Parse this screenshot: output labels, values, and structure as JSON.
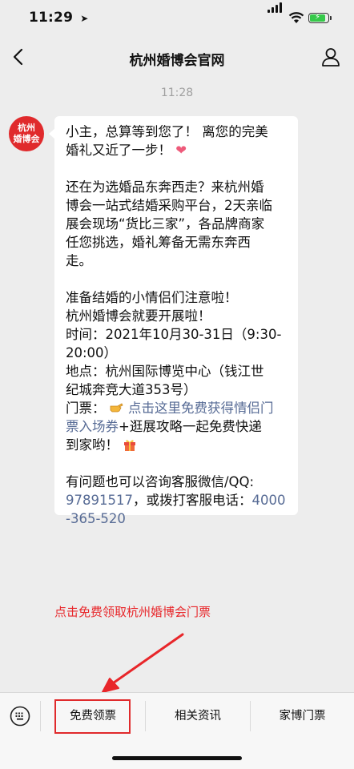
{
  "status": {
    "time": "11:29",
    "location_icon": "location-arrow-icon",
    "signal_icon": "cellular-signal-icon",
    "wifi_icon": "wifi-icon",
    "battery_icon": "battery-charging-icon",
    "battery_level_fraction": 0.85
  },
  "nav": {
    "back_icon": "chevron-left-icon",
    "title": "杭州婚博会官网",
    "profile_icon": "person-icon"
  },
  "chat": {
    "timestamp": "11:28",
    "avatar_text_line1": "杭州",
    "avatar_text_line2": "婚博会",
    "message": {
      "p1_line1": "小主，总算等到您了！ 离您的完美",
      "p1_line2": "婚礼又近了一步！",
      "heart_emoji": "❤",
      "p2_line1": "还在为选婚品东奔西走？来杭州婚",
      "p2_line2": "博会一站式结婚采购平台，2天亲临",
      "p2_line3": "展会现场“货比三家”，各品牌商家",
      "p2_line4": "任您挑选，婚礼筹备无需东奔西",
      "p2_line5": "走。",
      "p3_line1": "准备结婚的小情侣们注意啦！",
      "p3_line2": "杭州婚博会就要开展啦！",
      "p3_line3": "时间：2021年10月30-31日（9:30-",
      "p3_line4": "20:00）",
      "p3_line5": "地点：杭州国际博览中心（钱江世",
      "p3_line6": "纪城奔竞大道353号）",
      "p3_ticket_label": "门票：",
      "p3_ticket_link_a": "点击这里免费获得情侣门",
      "p3_ticket_link_b": "票入场券",
      "p3_ticket_rest": "+逛展攻略一起免费快递",
      "p3_line9": "到家哟！",
      "gift_emoji": "gift-icon",
      "hand_emoji": "pointing-hand-icon",
      "p4_line1": "有问题也可以咨询客服微信/QQ:",
      "p4_qq": "97891517",
      "p4_mid": "，或拨打客服电话：",
      "p4_phone_a": "4000",
      "p4_phone_b": "-365-520"
    }
  },
  "annotation": {
    "text": "点击免费领取杭州婚博会门票",
    "color": "#e8262a"
  },
  "menu": {
    "keyboard_icon": "keyboard-icon",
    "items": [
      {
        "label": "免费领票"
      },
      {
        "label": "相关资讯"
      },
      {
        "label": "家博门票"
      }
    ],
    "highlight_color": "#e02a2c"
  }
}
